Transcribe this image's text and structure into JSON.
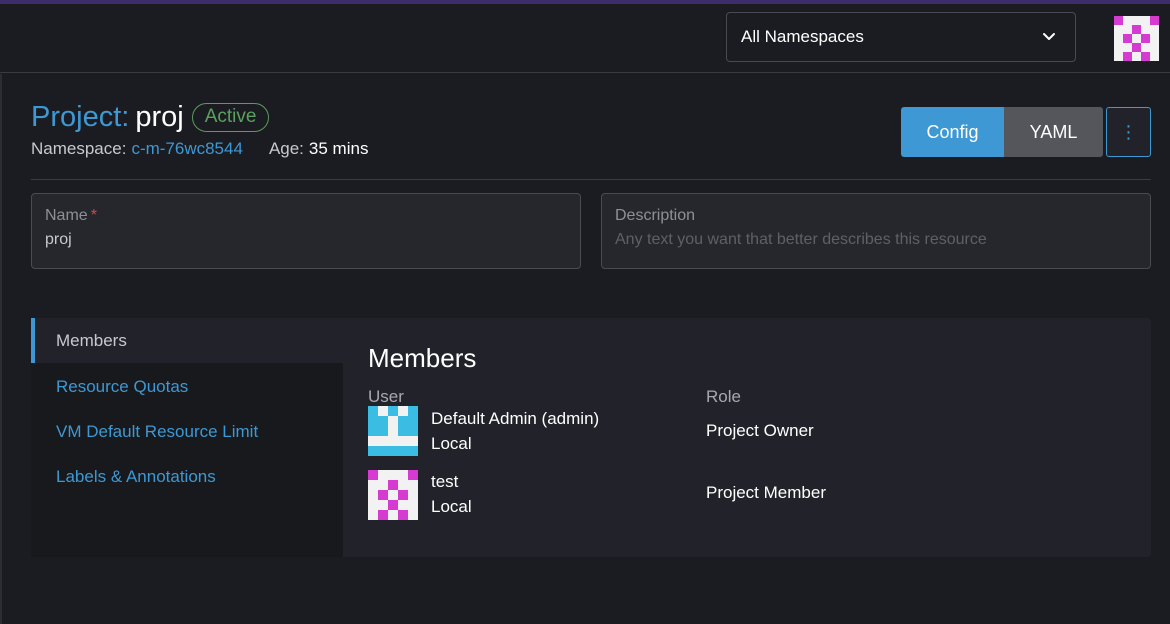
{
  "header": {
    "namespace_select": "All Namespaces"
  },
  "page": {
    "title_prefix": "Project:",
    "title_name": "proj",
    "status": "Active",
    "namespace_label": "Namespace:",
    "namespace_value": "c-m-76wc8544",
    "age_label": "Age:",
    "age_value": "35 mins"
  },
  "actions": {
    "config": "Config",
    "yaml": "YAML",
    "more": "⋮"
  },
  "form": {
    "name_label": "Name",
    "name_required": "*",
    "name_value": "proj",
    "description_label": "Description",
    "description_placeholder": "Any text you want that better describes this resource"
  },
  "tabs": [
    {
      "label": "Members"
    },
    {
      "label": "Resource Quotas"
    },
    {
      "label": "VM Default Resource Limit"
    },
    {
      "label": "Labels & Annotations"
    }
  ],
  "members": {
    "title": "Members",
    "col_user": "User",
    "col_role": "Role",
    "rows": [
      {
        "name": "Default Admin (admin)",
        "provider": "Local",
        "role": "Project Owner",
        "avatar_color": "#3bbde3"
      },
      {
        "name": "test",
        "provider": "Local",
        "role": "Project Member",
        "avatar_color": "#d63bd1"
      }
    ]
  },
  "colors": {
    "accent": "#3d98d3",
    "active_badge": "#5aa15d",
    "background": "#1b1c21"
  }
}
